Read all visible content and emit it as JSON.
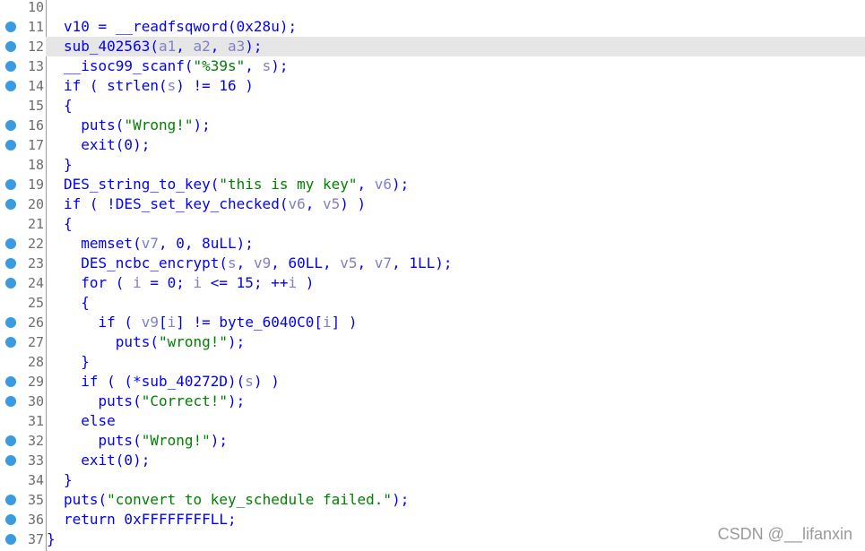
{
  "lines": [
    {
      "num": "10",
      "bp": false,
      "indent": "",
      "segs": []
    },
    {
      "num": "11",
      "bp": true,
      "indent": "",
      "segs": [
        [
          "v10 = __readfsqword(0x28u);",
          "n"
        ]
      ]
    },
    {
      "num": "12",
      "bp": true,
      "indent": "",
      "highlight": true,
      "segs": [
        [
          "sub_402563(",
          "n"
        ],
        [
          "a1",
          "v"
        ],
        [
          ", ",
          "n"
        ],
        [
          "a2",
          "v"
        ],
        [
          ", ",
          "n"
        ],
        [
          "a3",
          "v"
        ],
        [
          ");",
          "n"
        ]
      ]
    },
    {
      "num": "13",
      "bp": true,
      "indent": "",
      "segs": [
        [
          "__isoc99_scanf(",
          "n"
        ],
        [
          "\"%39s\"",
          "s"
        ],
        [
          ", ",
          "n"
        ],
        [
          "s",
          "v"
        ],
        [
          ");",
          "n"
        ]
      ]
    },
    {
      "num": "14",
      "bp": true,
      "indent": "",
      "segs": [
        [
          "if ( strlen(",
          "n"
        ],
        [
          "s",
          "v"
        ],
        [
          ") != 16 )",
          "n"
        ]
      ]
    },
    {
      "num": "15",
      "bp": false,
      "indent": "",
      "segs": [
        [
          "{",
          "n"
        ]
      ]
    },
    {
      "num": "16",
      "bp": true,
      "indent": "  ",
      "segs": [
        [
          "puts(",
          "n"
        ],
        [
          "\"Wrong!\"",
          "s"
        ],
        [
          ");",
          "n"
        ]
      ]
    },
    {
      "num": "17",
      "bp": true,
      "indent": "  ",
      "segs": [
        [
          "exit(0);",
          "n"
        ]
      ]
    },
    {
      "num": "18",
      "bp": false,
      "indent": "",
      "segs": [
        [
          "}",
          "n"
        ]
      ]
    },
    {
      "num": "19",
      "bp": true,
      "indent": "",
      "segs": [
        [
          "DES_string_to_key(",
          "n"
        ],
        [
          "\"this is my key\"",
          "s"
        ],
        [
          ", ",
          "n"
        ],
        [
          "v6",
          "v"
        ],
        [
          ");",
          "n"
        ]
      ]
    },
    {
      "num": "20",
      "bp": true,
      "indent": "",
      "segs": [
        [
          "if ( !DES_set_key_checked(",
          "n"
        ],
        [
          "v6",
          "v"
        ],
        [
          ", ",
          "n"
        ],
        [
          "v5",
          "v"
        ],
        [
          ") )",
          "n"
        ]
      ]
    },
    {
      "num": "21",
      "bp": false,
      "indent": "",
      "segs": [
        [
          "{",
          "n"
        ]
      ]
    },
    {
      "num": "22",
      "bp": true,
      "indent": "  ",
      "segs": [
        [
          "memset(",
          "n"
        ],
        [
          "v7",
          "v"
        ],
        [
          ", 0, 8uLL);",
          "n"
        ]
      ]
    },
    {
      "num": "23",
      "bp": true,
      "indent": "  ",
      "segs": [
        [
          "DES_ncbc_encrypt(",
          "n"
        ],
        [
          "s",
          "v"
        ],
        [
          ", ",
          "n"
        ],
        [
          "v9",
          "v"
        ],
        [
          ", 60LL, ",
          "n"
        ],
        [
          "v5",
          "v"
        ],
        [
          ", ",
          "n"
        ],
        [
          "v7",
          "v"
        ],
        [
          ", 1LL);",
          "n"
        ]
      ]
    },
    {
      "num": "24",
      "bp": true,
      "indent": "  ",
      "segs": [
        [
          "for ( ",
          "n"
        ],
        [
          "i",
          "v"
        ],
        [
          " = 0; ",
          "n"
        ],
        [
          "i",
          "v"
        ],
        [
          " <= 15; ++",
          "n"
        ],
        [
          "i",
          "v"
        ],
        [
          " )",
          "n"
        ]
      ]
    },
    {
      "num": "25",
      "bp": false,
      "indent": "  ",
      "segs": [
        [
          "{",
          "n"
        ]
      ]
    },
    {
      "num": "26",
      "bp": true,
      "indent": "    ",
      "segs": [
        [
          "if ( ",
          "n"
        ],
        [
          "v9",
          "v"
        ],
        [
          "[",
          "n"
        ],
        [
          "i",
          "v"
        ],
        [
          "] != byte_6040C0[",
          "n"
        ],
        [
          "i",
          "v"
        ],
        [
          "] )",
          "n"
        ]
      ]
    },
    {
      "num": "27",
      "bp": true,
      "indent": "      ",
      "segs": [
        [
          "puts(",
          "n"
        ],
        [
          "\"wrong!\"",
          "s"
        ],
        [
          ");",
          "n"
        ]
      ]
    },
    {
      "num": "28",
      "bp": false,
      "indent": "  ",
      "segs": [
        [
          "}",
          "n"
        ]
      ]
    },
    {
      "num": "29",
      "bp": true,
      "indent": "  ",
      "segs": [
        [
          "if ( (*sub_40272D)(",
          "n"
        ],
        [
          "s",
          "v"
        ],
        [
          ") )",
          "n"
        ]
      ]
    },
    {
      "num": "30",
      "bp": true,
      "indent": "    ",
      "segs": [
        [
          "puts(",
          "n"
        ],
        [
          "\"Correct!\"",
          "s"
        ],
        [
          ");",
          "n"
        ]
      ]
    },
    {
      "num": "31",
      "bp": false,
      "indent": "  ",
      "segs": [
        [
          "else",
          "n"
        ]
      ]
    },
    {
      "num": "32",
      "bp": true,
      "indent": "    ",
      "segs": [
        [
          "puts(",
          "n"
        ],
        [
          "\"Wrong!\"",
          "s"
        ],
        [
          ");",
          "n"
        ]
      ]
    },
    {
      "num": "33",
      "bp": true,
      "indent": "  ",
      "segs": [
        [
          "exit(0);",
          "n"
        ]
      ]
    },
    {
      "num": "34",
      "bp": false,
      "indent": "",
      "segs": [
        [
          "}",
          "n"
        ]
      ]
    },
    {
      "num": "35",
      "bp": true,
      "indent": "",
      "segs": [
        [
          "puts(",
          "n"
        ],
        [
          "\"convert to key_schedule failed.\"",
          "s"
        ],
        [
          ");",
          "n"
        ]
      ]
    },
    {
      "num": "36",
      "bp": true,
      "indent": "",
      "segs": [
        [
          "return 0xFFFFFFFFLL;",
          "n"
        ]
      ]
    },
    {
      "num": "37",
      "bp": true,
      "indent": "",
      "closing": true,
      "segs": [
        [
          "}",
          "n"
        ]
      ]
    }
  ],
  "watermark": "CSDN @__lifanxin",
  "colors": {
    "keyword": "#0000ff",
    "variable": "#8080c8",
    "string": "#008000",
    "line_number": "#6e6e6e",
    "highlight": "#e6e6e6",
    "breakpoint": "#3a9be0"
  }
}
